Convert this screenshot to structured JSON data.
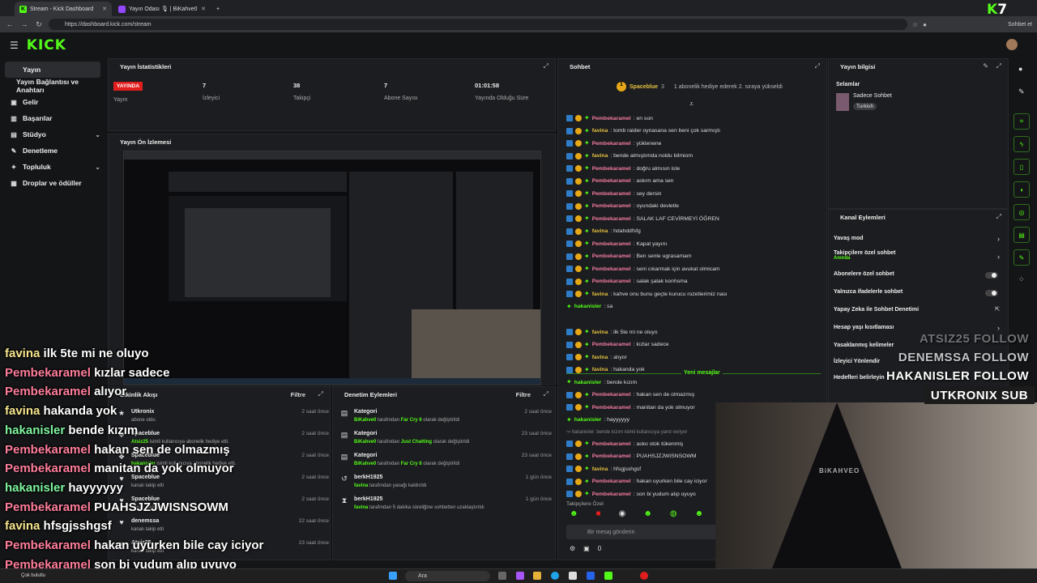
{
  "browser": {
    "tabs": [
      {
        "label": "Stream - Kick Dashboard"
      },
      {
        "label": "Yayın Odası 🎙 | BiKahve0"
      }
    ],
    "url": "https://dashboard.kick.com/stream",
    "copilot": "Sohbet et"
  },
  "brand": {
    "logo": "KICK",
    "corner_logo_k": "K",
    "corner_logo_7": "7"
  },
  "sidebar": {
    "items": [
      {
        "label": "Yayın"
      },
      {
        "label": "Yayın Bağlantısı ve Anahtarı"
      },
      {
        "label": "Gelir"
      },
      {
        "label": "Başarılar"
      },
      {
        "label": "Stüdyo"
      },
      {
        "label": "Denetleme"
      },
      {
        "label": "Topluluk"
      },
      {
        "label": "Droplar ve ödüller"
      }
    ]
  },
  "stats": {
    "title": "Yayın İstatistikleri",
    "badge": "YAYINDA",
    "items": [
      {
        "value": "",
        "label": "Yayın"
      },
      {
        "value": "7",
        "label": "İzleyici"
      },
      {
        "value": "38",
        "label": "Takipçi"
      },
      {
        "value": "7",
        "label": "Abone Sayısı"
      },
      {
        "value": "01:01:58",
        "label": "Yayında Olduğu Süre"
      }
    ]
  },
  "preview": {
    "title": "Yayın Ön İzlemesi"
  },
  "activity": {
    "title": "Etkinlik Akışı",
    "filter": "Filtre",
    "items": [
      {
        "name": "Utkronix",
        "sub": "abone oldu",
        "time": "2 saat önce"
      },
      {
        "name": "Spaceblue",
        "sub_user": "Atsiz25",
        "sub": "isimli kullanıcıya abonelik hediye etti.",
        "time": "2 saat önce"
      },
      {
        "name": "Spaceblue",
        "sub_user": "hakanisler",
        "sub": "isimli kullanıcıya abonelik hediye etti.",
        "time": "2 saat önce"
      },
      {
        "name": "Spaceblue",
        "sub": "kanalı takip etti",
        "time": "2 saat önce"
      },
      {
        "name": "Spaceblue",
        "sub": "kanalı takip etti",
        "time": "2 saat önce"
      },
      {
        "name": "denemssa",
        "sub": "kanalı takip etti",
        "time": "22 saat önce"
      },
      {
        "name": "Atsiz25",
        "sub": "kanalı takip etti",
        "time": "23 saat önce"
      }
    ]
  },
  "moderation": {
    "title": "Denetim Eylemleri",
    "filter": "Filtre",
    "items": [
      {
        "title": "Kategori",
        "actor": "BiKahve0",
        "mid": "tarafından",
        "target": "Far Cry 6",
        "suffix": "olarak değiştirildi",
        "time": "2 saat önce"
      },
      {
        "title": "Kategori",
        "actor": "BiKahve0",
        "mid": "tarafından",
        "target": "Just Chatting",
        "suffix": "olarak değiştirildi",
        "time": "23 saat önce"
      },
      {
        "title": "Kategori",
        "actor": "BiKahve0",
        "mid": "tarafından",
        "target": "Far Cry 6",
        "suffix": "olarak değiştirildi",
        "time": "23 saat önce"
      },
      {
        "title": "berkH1925",
        "actor": "favina",
        "mid": "tarafından yasağı kaldırıldı",
        "target": "",
        "suffix": "",
        "time": "1 gün önce"
      },
      {
        "title": "berkH1925",
        "actor": "favina",
        "mid": "tarafından 5 dakika süreliğine sohbetten uzaklaştırıldı",
        "target": "",
        "suffix": "",
        "time": "1 gün önce"
      }
    ]
  },
  "chat": {
    "title": "Sohbet",
    "pinned_user": "Spaceblue",
    "pinned_count": "3",
    "pinned_text": "1 abonelik hediye ederek 2. sıraya yükseldi",
    "messages": [
      {
        "user": "Pembekaramel",
        "cls": "pk",
        "text": "en son"
      },
      {
        "user": "favina",
        "cls": "fv",
        "text": "tomb raider oynasana sen beni çok sarmıştı"
      },
      {
        "user": "Pembekaramel",
        "cls": "pk",
        "text": "yüklenene"
      },
      {
        "user": "favina",
        "cls": "fv",
        "text": "bende almıştımda noldu bilmiom"
      },
      {
        "user": "Pembekaramel",
        "cls": "pk",
        "text": "doğru almısın iste"
      },
      {
        "user": "Pembekaramel",
        "cls": "pk",
        "text": "askım ama sen"
      },
      {
        "user": "Pembekaramel",
        "cls": "pk",
        "text": "sey dersin"
      },
      {
        "user": "Pembekaramel",
        "cls": "pk",
        "text": "oyundaki devletle"
      },
      {
        "user": "Pembekaramel",
        "cls": "pk",
        "text": "SALAK LAF CEVİRMEYİ ÖĞREN"
      },
      {
        "user": "favina",
        "cls": "fv",
        "text": "hdahddfsfg"
      },
      {
        "user": "Pembekaramel",
        "cls": "pk",
        "text": "Kapat yayını"
      },
      {
        "user": "Pembekaramel",
        "cls": "pk",
        "text": "Ben senle ugrasamam"
      },
      {
        "user": "Pembekaramel",
        "cls": "pk",
        "text": "seni cıkarmak için avukat olmicam"
      },
      {
        "user": "Pembekaramel",
        "cls": "pk",
        "text": "salak şalak konhsma"
      },
      {
        "user": "favina",
        "cls": "fv",
        "text": "kahve onu bunu geçte kurucu rozetlerimiz nası"
      },
      {
        "user": "hakanisler",
        "cls": "hk",
        "text": "sa"
      }
    ],
    "new_label": "Yeni mesajlar",
    "new_messages": [
      {
        "user": "favina",
        "cls": "fv",
        "text": "ilk 5te mi ne oluyo"
      },
      {
        "user": "Pembekaramel",
        "cls": "pk",
        "text": "kızlar sadece"
      },
      {
        "user": "favina",
        "cls": "fv",
        "text": "alıyor"
      },
      {
        "user": "favina",
        "cls": "fv",
        "text": "hakanda yok"
      },
      {
        "user": "hakanisler",
        "cls": "hk",
        "text": "bende kızım"
      },
      {
        "user": "Pembekaramel",
        "cls": "pk",
        "text": "hakan sen de olmazmış"
      },
      {
        "user": "Pembekaramel",
        "cls": "pk",
        "text": "manitan da yok olmuyor"
      },
      {
        "user": "hakanisler",
        "cls": "hk",
        "text": "hayyyyyy"
      },
      {
        "user": "hakanisler",
        "cls": "reply",
        "text": "bende kızım isimli kullanıcıya yanıt veriyor"
      },
      {
        "user": "Pembekaramel",
        "cls": "pk",
        "text": "asko stok tükenmiş"
      },
      {
        "user": "Pembekaramel",
        "cls": "pk",
        "text": "PUAHSJZJWISNSOWM"
      },
      {
        "user": "favina",
        "cls": "fv",
        "text": "hfsgjsshgsf"
      },
      {
        "user": "Pembekaramel",
        "cls": "pk",
        "text": "hakan uyurken bile cay iciyor"
      },
      {
        "user": "Pembekaramel",
        "cls": "pk",
        "text": "son bi yudum alıp uyuyo"
      }
    ],
    "followers_only": "Takipçilere Özel",
    "input_placeholder": "Bir mesaj gönderin",
    "bottom_count": "0"
  },
  "info": {
    "title": "Yayın bilgisi",
    "stream_title": "Selamlar",
    "category": "Sadece Sohbet",
    "tag": "Turkish"
  },
  "actions": {
    "title": "Kanal Eylemleri",
    "items": [
      {
        "label": "Yavaş mod",
        "sub": ""
      },
      {
        "label": "Takipçilere özel sohbet",
        "sub": "Anında"
      },
      {
        "label": "Abonelere özel sohbet",
        "sub": ""
      },
      {
        "label": "Yalnızca ifadelerle sohbet",
        "sub": ""
      },
      {
        "label": "Yapay Zeka ile Sohbet Denetimi",
        "sub": ""
      },
      {
        "label": "Hesap yaşı kısıtlaması",
        "sub": ""
      },
      {
        "label": "Yasaklanmış kelimeler",
        "sub": ""
      },
      {
        "label": "İzleyici Yönlendir",
        "sub": ""
      },
      {
        "label": "Hedefleri belirleyin",
        "sub": ""
      }
    ]
  },
  "overlay": {
    "chat": [
      {
        "user": "favina",
        "cls": "fv2",
        "text": "ilk 5te mi ne oluyo"
      },
      {
        "user": "Pembekaramel",
        "cls": "pk2",
        "text": "kızlar sadece"
      },
      {
        "user": "Pembekaramel",
        "cls": "pk2",
        "text": "alıyor"
      },
      {
        "user": "favina",
        "cls": "fv2",
        "text": "hakanda yok"
      },
      {
        "user": "hakanisler",
        "cls": "hk2",
        "text": "bende kızım"
      },
      {
        "user": "Pembekaramel",
        "cls": "pk2",
        "text": "hakan sen de olmazmış"
      },
      {
        "user": "Pembekaramel",
        "cls": "pk2",
        "text": "manitan da yok olmuyor"
      },
      {
        "user": "hakanisler",
        "cls": "hk2",
        "text": "hayyyyyy"
      },
      {
        "user": "Pembekaramel",
        "cls": "pk2",
        "text": "PUAHSJZJWISNSOWM"
      },
      {
        "user": "favina",
        "cls": "fv2",
        "text": "hfsgjsshgsf"
      },
      {
        "user": "Pembekaramel",
        "cls": "pk2",
        "text": "hakan uyurken bile cay iciyor"
      },
      {
        "user": "Pembekaramel",
        "cls": "pk2",
        "text": "son bi yudum alıp uyuyo"
      }
    ],
    "follows": [
      "ATSIZ25 FOLLOW",
      "DENEMSSA FOLLOW",
      "HAKANISLER FOLLOW"
    ],
    "sub": "UTKRONIX SUB",
    "hood_text": "BiKAHVEO"
  },
  "taskbar": {
    "search": "Ara",
    "weather": "Çok bulutlu"
  }
}
